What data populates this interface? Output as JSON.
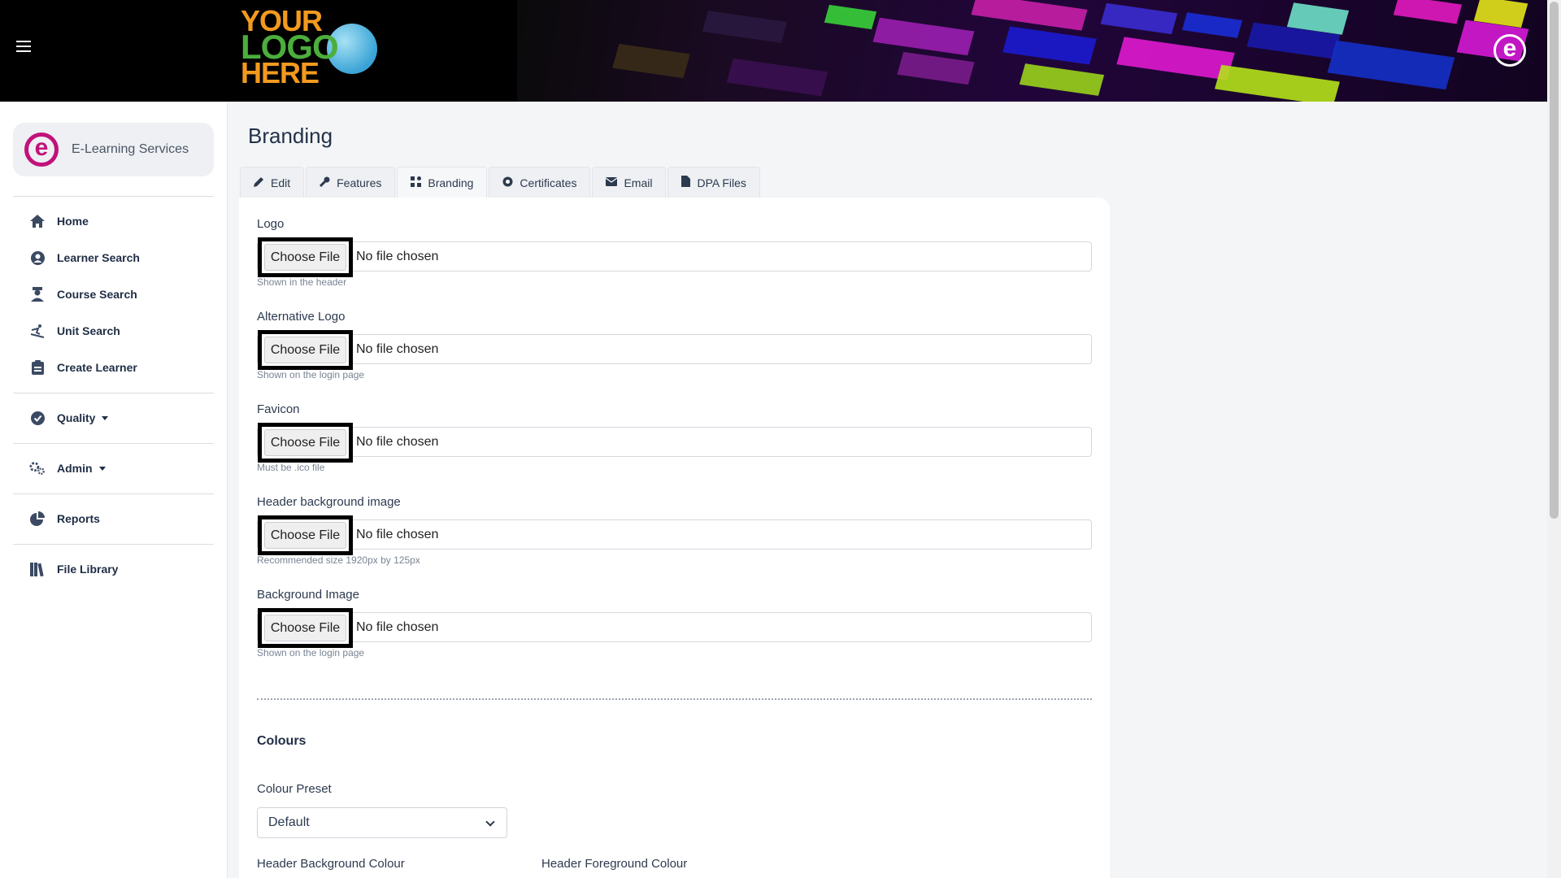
{
  "header": {
    "logo_lines": [
      "YOUR",
      "LOGO",
      "HERE"
    ],
    "brand_letter": "e"
  },
  "sidebar": {
    "org_letter": "e",
    "org_name": "E-Learning Services",
    "items": [
      {
        "label": "Home",
        "icon": "home-icon"
      },
      {
        "label": "Learner Search",
        "icon": "user-circle-icon"
      },
      {
        "label": "Course Search",
        "icon": "graduate-icon"
      },
      {
        "label": "Unit Search",
        "icon": "skiing-icon"
      },
      {
        "label": "Create Learner",
        "icon": "clipboard-icon"
      },
      {
        "label": "Quality",
        "icon": "check-circle-icon"
      },
      {
        "label": "Admin",
        "icon": "gears-icon"
      },
      {
        "label": "Reports",
        "icon": "pie-chart-icon"
      },
      {
        "label": "File Library",
        "icon": "books-icon"
      }
    ]
  },
  "page": {
    "title": "Branding",
    "tabs": [
      {
        "label": "Edit",
        "icon": "pencil-icon"
      },
      {
        "label": "Features",
        "icon": "wrench-icon"
      },
      {
        "label": "Branding",
        "icon": "palette-icon",
        "active": true
      },
      {
        "label": "Certificates",
        "icon": "certificate-icon"
      },
      {
        "label": "Email",
        "icon": "envelope-icon"
      },
      {
        "label": "DPA Files",
        "icon": "file-icon"
      }
    ]
  },
  "form": {
    "files": [
      {
        "label": "Logo",
        "button": "Choose File",
        "status": "No file chosen",
        "help": "Shown in the header"
      },
      {
        "label": "Alternative Logo",
        "button": "Choose File",
        "status": "No file chosen",
        "help": "Shown on the login page"
      },
      {
        "label": "Favicon",
        "button": "Choose File",
        "status": "No file chosen",
        "help": "Must be .ico file"
      },
      {
        "label": "Header background image",
        "button": "Choose File",
        "status": "No file chosen",
        "help": "Recommended size 1920px by 125px"
      },
      {
        "label": "Background Image",
        "button": "Choose File",
        "status": "No file chosen",
        "help": "Shown on the login page"
      }
    ],
    "colours_title": "Colours",
    "preset_label": "Colour Preset",
    "preset_value": "Default",
    "header_bg_label": "Header Background Colour",
    "header_fg_label": "Header Foreground Colour"
  },
  "colors": {
    "accent": "#c1127a",
    "logo_orange": "#f39a1e",
    "logo_green": "#4cae3d",
    "logo_blue": "#3aa3d6"
  }
}
